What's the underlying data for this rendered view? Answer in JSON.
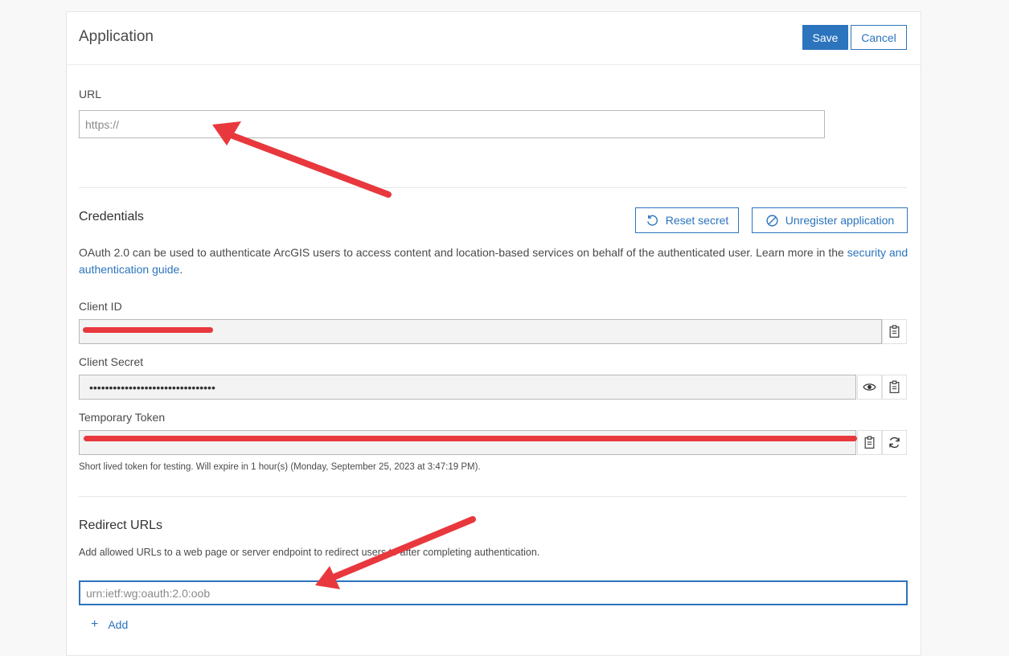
{
  "header": {
    "title": "Application",
    "save_label": "Save",
    "cancel_label": "Cancel"
  },
  "url_section": {
    "label": "URL",
    "placeholder": "https://"
  },
  "credentials": {
    "title": "Credentials",
    "reset_secret_label": "Reset secret",
    "unregister_label": "Unregister application",
    "description_prefix": "OAuth 2.0 can be used to authenticate ArcGIS users to access content and location-based services on behalf of the authenticated user. Learn more in the ",
    "description_link": "security and authentication guide",
    "description_suffix": ".",
    "client_id_label": "Client ID",
    "client_id_value": "",
    "client_secret_label": "Client Secret",
    "client_secret_value": "••••••••••••••••••••••••••••••••",
    "temp_token_label": "Temporary Token",
    "temp_token_value": "",
    "temp_token_note": "Short lived token for testing. Will expire in 1 hour(s) (Monday, September 25, 2023 at 3:47:19 PM)."
  },
  "redirect": {
    "title": "Redirect URLs",
    "description": "Add allowed URLs to a web page or server endpoint to redirect users to after completing authentication.",
    "placeholder": "urn:ietf:wg:oauth:2.0:oob",
    "add_label": "Add"
  },
  "icons": {
    "reset": "rotate-icon",
    "unregister": "prohibited-icon",
    "copy": "clipboard-icon",
    "view": "eye-icon",
    "refresh": "refresh-icon",
    "add": "plus-icon"
  },
  "colors": {
    "accent": "#2c74bd",
    "annotation": "#e8383d"
  }
}
